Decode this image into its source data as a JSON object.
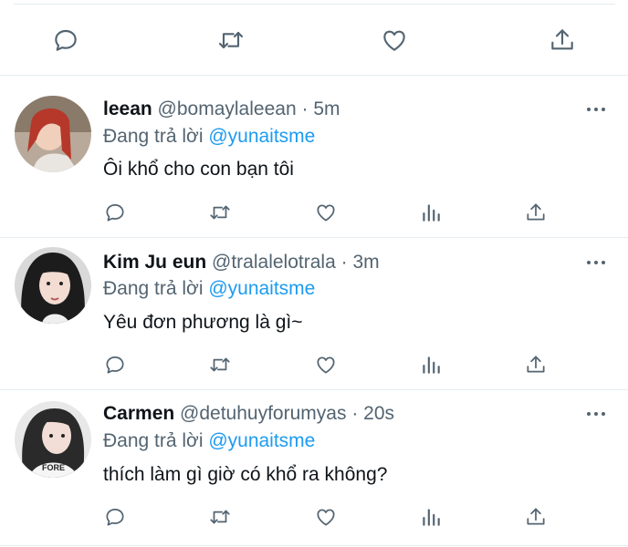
{
  "colors": {
    "text": "#0f1419",
    "secondary": "#536471",
    "accent": "#1d9bf0",
    "divider": "#e6ecf0"
  },
  "top_actions": [
    "reply-icon",
    "retweet-icon",
    "like-icon",
    "share-icon"
  ],
  "tweets": [
    {
      "name": "leean",
      "handle": "@bomaylaleean",
      "separator": "·",
      "time": "5m",
      "reply_prefix": "Đang trả lời",
      "reply_to": "@yunaitsme",
      "text": "Ôi khổ cho con bạn tôi"
    },
    {
      "name": "Kim Ju eun",
      "handle": "@tralalelotrala",
      "separator": "·",
      "time": "3m",
      "reply_prefix": "Đang trả lời",
      "reply_to": "@yunaitsme",
      "text": "Yêu đơn phương là gì~"
    },
    {
      "name": "Carmen",
      "handle": "@detuhuyforumyas",
      "separator": "·",
      "time": "20s",
      "reply_prefix": "Đang trả lời",
      "reply_to": "@yunaitsme",
      "text": "thích làm gì giờ có khổ ra không?"
    }
  ]
}
